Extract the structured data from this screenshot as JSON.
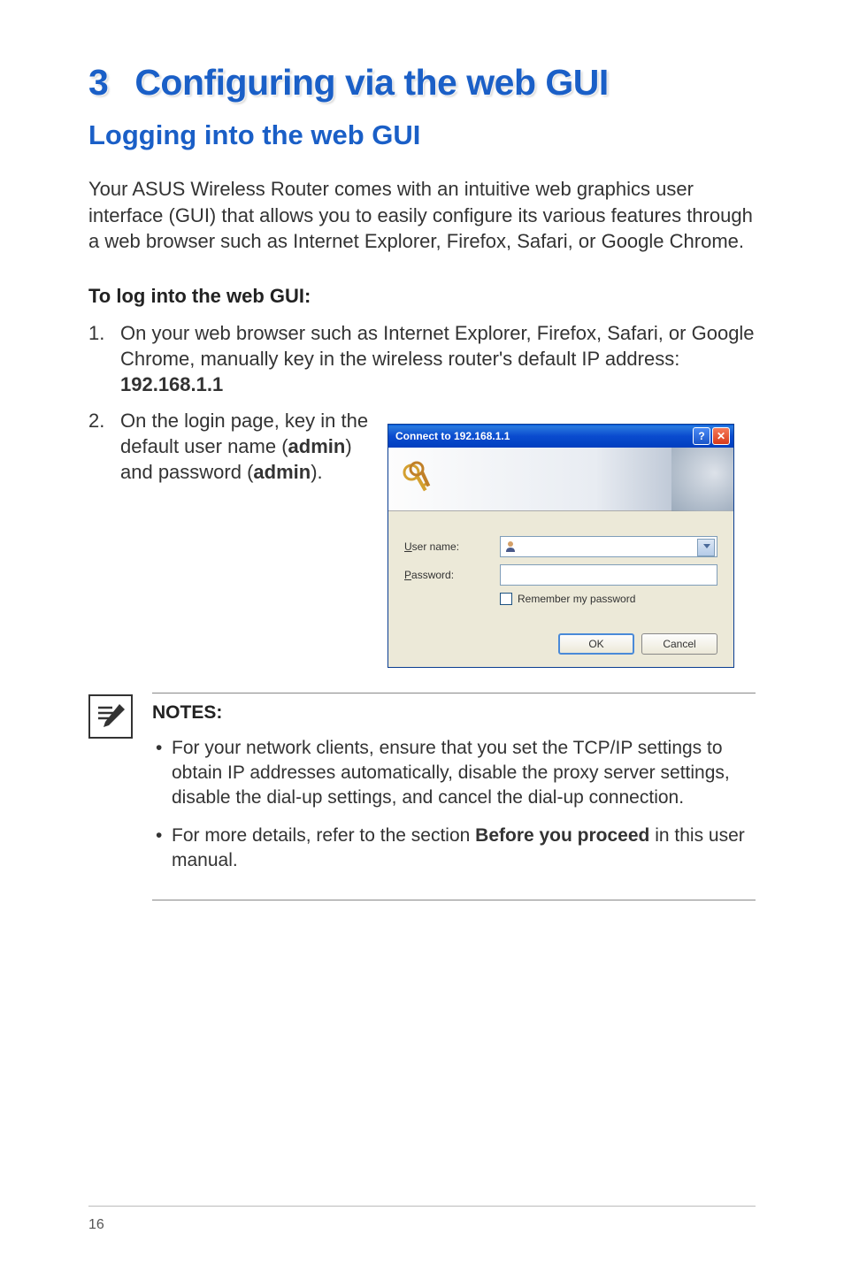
{
  "chapter": {
    "number": "3",
    "title": "Configuring via the web GUI"
  },
  "section": {
    "title": "Logging into the web GUI"
  },
  "intro": "Your ASUS Wireless Router comes with an intuitive web graphics user interface (GUI) that allows you to easily configure its various features through a web browser such as Internet Explorer, Firefox, Safari, or Google Chrome.",
  "subheading": "To log into the web GUI:",
  "steps": {
    "one": {
      "num": "1.",
      "text_a": "On your web browser such as Internet Explorer, Firefox, Safari, or Google Chrome, manually key in the wireless router's default IP address: ",
      "ip": "192.168.1.1"
    },
    "two": {
      "num": "2.",
      "text_a": "On the login page, key in the default user name (",
      "admin1": "admin",
      "text_b": ") and password (",
      "admin2": "admin",
      "text_c": ")."
    }
  },
  "dialog": {
    "title": "Connect to 192.168.1.1",
    "username_label_u": "U",
    "username_label_rest": "ser name:",
    "password_label_p": "P",
    "password_label_rest": "assword:",
    "remember_r": "R",
    "remember_rest": "emember my password",
    "ok": "OK",
    "cancel": "Cancel"
  },
  "notes": {
    "heading": "NOTES",
    "colon": ":",
    "bullet1": "For your network clients, ensure that you set the TCP/IP settings to obtain IP addresses automatically, disable the proxy server settings, disable the dial-up settings, and cancel the dial-up connection.",
    "bullet2_a": "For more details, refer to the section ",
    "bullet2_bold": "Before you proceed",
    "bullet2_b": " in this user manual."
  },
  "page_number": "16"
}
